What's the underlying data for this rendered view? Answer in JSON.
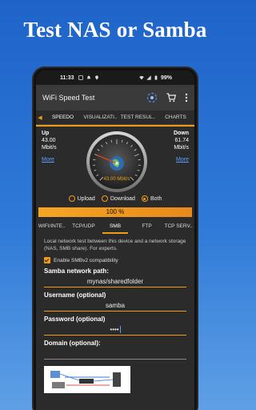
{
  "headline": "Test NAS or Samba",
  "status_bar": {
    "time": "11:33",
    "battery": "99%"
  },
  "app_bar": {
    "title": "WiFi Speed Test"
  },
  "top_tabs": [
    "SPEEDO",
    "VISUALIZATI..",
    "TEST RESUL..",
    "CHARTS"
  ],
  "gauge": {
    "up_label": "Up",
    "up_value": "43.00",
    "up_unit": "Mbit/s",
    "down_label": "Down",
    "down_value": "61.74",
    "down_unit": "Mbit/s",
    "more_label": "More",
    "center_readout": "43.00 Mbit/s",
    "needle_fraction": 0.25
  },
  "radio_options": [
    {
      "label": "Upload",
      "selected": false
    },
    {
      "label": "Download",
      "selected": false
    },
    {
      "label": "Both",
      "selected": true
    }
  ],
  "progress": {
    "text": "100 %",
    "fraction": 1.0
  },
  "protocol_tabs": [
    "WIFI/INTE..",
    "TCP/UDP",
    "SMB",
    "FTP",
    "TCP SERV.."
  ],
  "active_protocol_tab": "SMB",
  "panel": {
    "description": "Local network test between this device and a network storage (NAS, SMB share). For experts.",
    "smb_checkbox_label": "Enable SMBv2 compatibility",
    "path_label": "Samba network path:",
    "path_value": "mynas/sharedfolder",
    "username_label": "Username (optional)",
    "username_value": "samba",
    "password_label": "Password (optional)",
    "password_value": "••••",
    "domain_label": "Domain (optional):",
    "domain_value": ""
  },
  "colors": {
    "accent": "#f39c12",
    "background_top": "#1f63c9",
    "screen": "#2b2b2b"
  }
}
